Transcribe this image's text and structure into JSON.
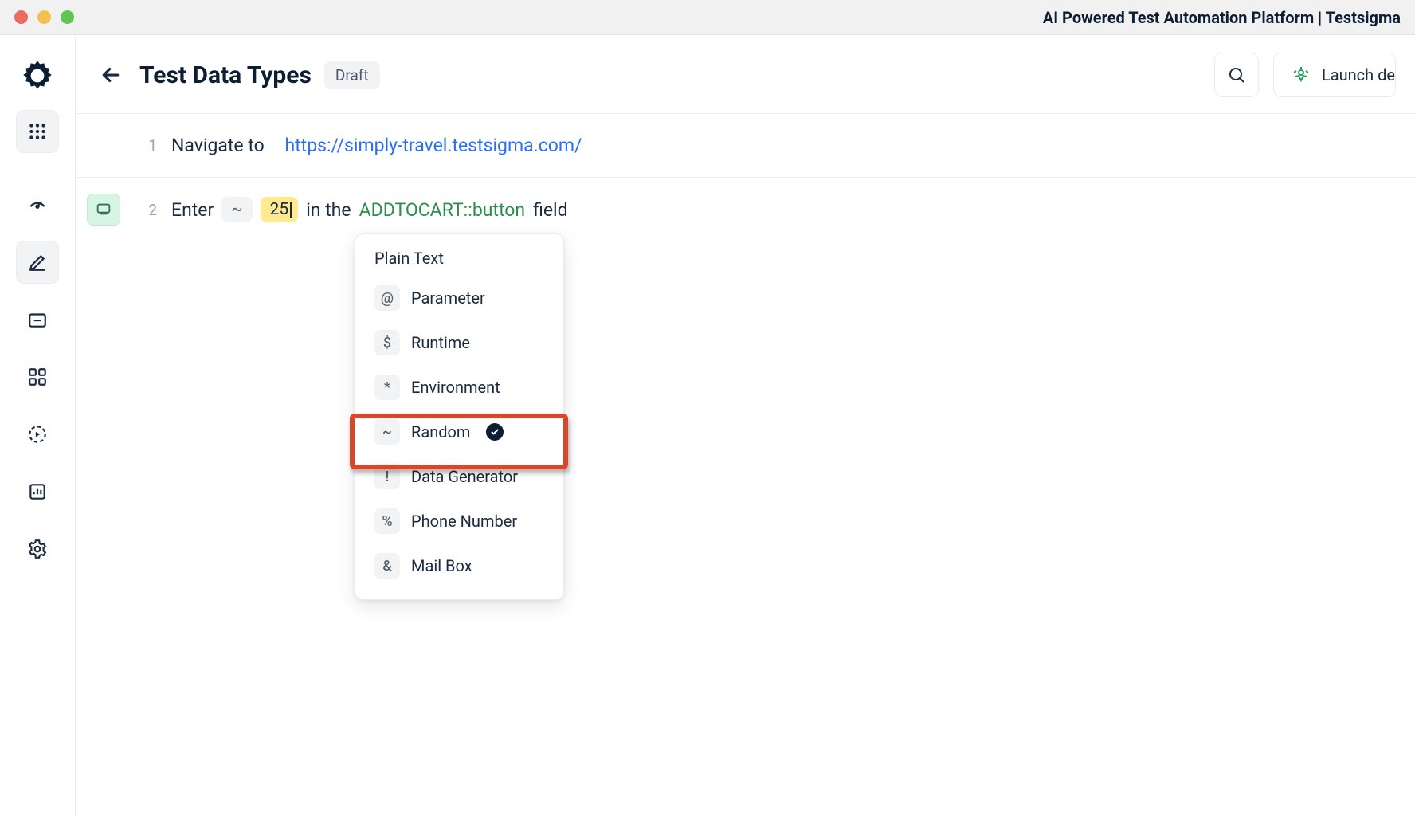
{
  "window": {
    "title": "AI Powered Test Automation Platform | Testsigma"
  },
  "header": {
    "title": "Test Data Types",
    "status": "Draft",
    "launch_label": "Launch de"
  },
  "steps": [
    {
      "num": "1",
      "prefix": "Navigate to",
      "url": "https://simply-travel.testsigma.com/"
    },
    {
      "num": "2",
      "prefix": "Enter",
      "type_symbol": "~",
      "value": "25",
      "mid": "in the",
      "element": "ADDTOCART::button",
      "suffix": "field"
    }
  ],
  "dropdown": {
    "header": "Plain Text",
    "items": [
      {
        "symbol": "@",
        "label": "Parameter",
        "selected": false
      },
      {
        "symbol": "$",
        "label": "Runtime",
        "selected": false
      },
      {
        "symbol": "*",
        "label": "Environment",
        "selected": false
      },
      {
        "symbol": "~",
        "label": "Random",
        "selected": true
      },
      {
        "symbol": "!",
        "label": "Data Generator",
        "selected": false
      },
      {
        "symbol": "%",
        "label": "Phone Number",
        "selected": false
      },
      {
        "symbol": "&",
        "label": "Mail Box",
        "selected": false
      }
    ]
  }
}
